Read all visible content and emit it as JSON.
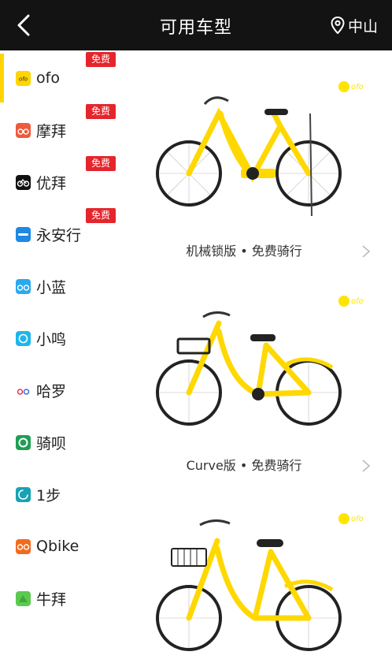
{
  "header": {
    "title": "可用车型",
    "location": "中山",
    "back_icon": "chevron-left-icon",
    "location_icon": "location-pin-icon",
    "background": "#131313"
  },
  "sidebar": {
    "active_index": 0,
    "active_color": "#ffd400",
    "items": [
      {
        "label": "ofo",
        "badge": "免费",
        "icon": "ofo-logo-icon",
        "color": "#ffd400"
      },
      {
        "label": "摩拜",
        "badge": "免费",
        "icon": "mobike-logo-icon",
        "color": "#f05a3a"
      },
      {
        "label": "优拜",
        "badge": "免费",
        "icon": "ubike-logo-icon",
        "color": "#111111"
      },
      {
        "label": "永安行",
        "badge": "免费",
        "icon": "youon-logo-icon",
        "color": "#1e88e5"
      },
      {
        "label": "小蓝",
        "badge": "",
        "icon": "bluegogo-logo-icon",
        "color": "#29a9f0"
      },
      {
        "label": "小鸣",
        "badge": "",
        "icon": "xiaoming-logo-icon",
        "color": "#1fb6ea"
      },
      {
        "label": "哈罗",
        "badge": "",
        "icon": "hellobike-logo-icon",
        "color": "#e3325a"
      },
      {
        "label": "骑呗",
        "badge": "",
        "icon": "qibei-logo-icon",
        "color": "#1f9e55"
      },
      {
        "label": "1步",
        "badge": "",
        "icon": "yibu-logo-icon",
        "color": "#16a3b5"
      },
      {
        "label": "Qbike",
        "badge": "",
        "icon": "qbike-logo-icon",
        "color": "#f26b1d"
      },
      {
        "label": "牛拜",
        "badge": "",
        "icon": "niubai-logo-icon",
        "color": "#5cc94f"
      }
    ],
    "badge_color": "#e5252c"
  },
  "bikes": [
    {
      "model": "机械锁版 • 免费骑行",
      "brand_mark": "ofo",
      "bike_color": "#ffd800"
    },
    {
      "model": "Curve版 • 免费骑行",
      "brand_mark": "ofo",
      "bike_color": "#ffd800"
    },
    {
      "model": "",
      "brand_mark": "ofo",
      "bike_color": "#ffd800"
    }
  ]
}
